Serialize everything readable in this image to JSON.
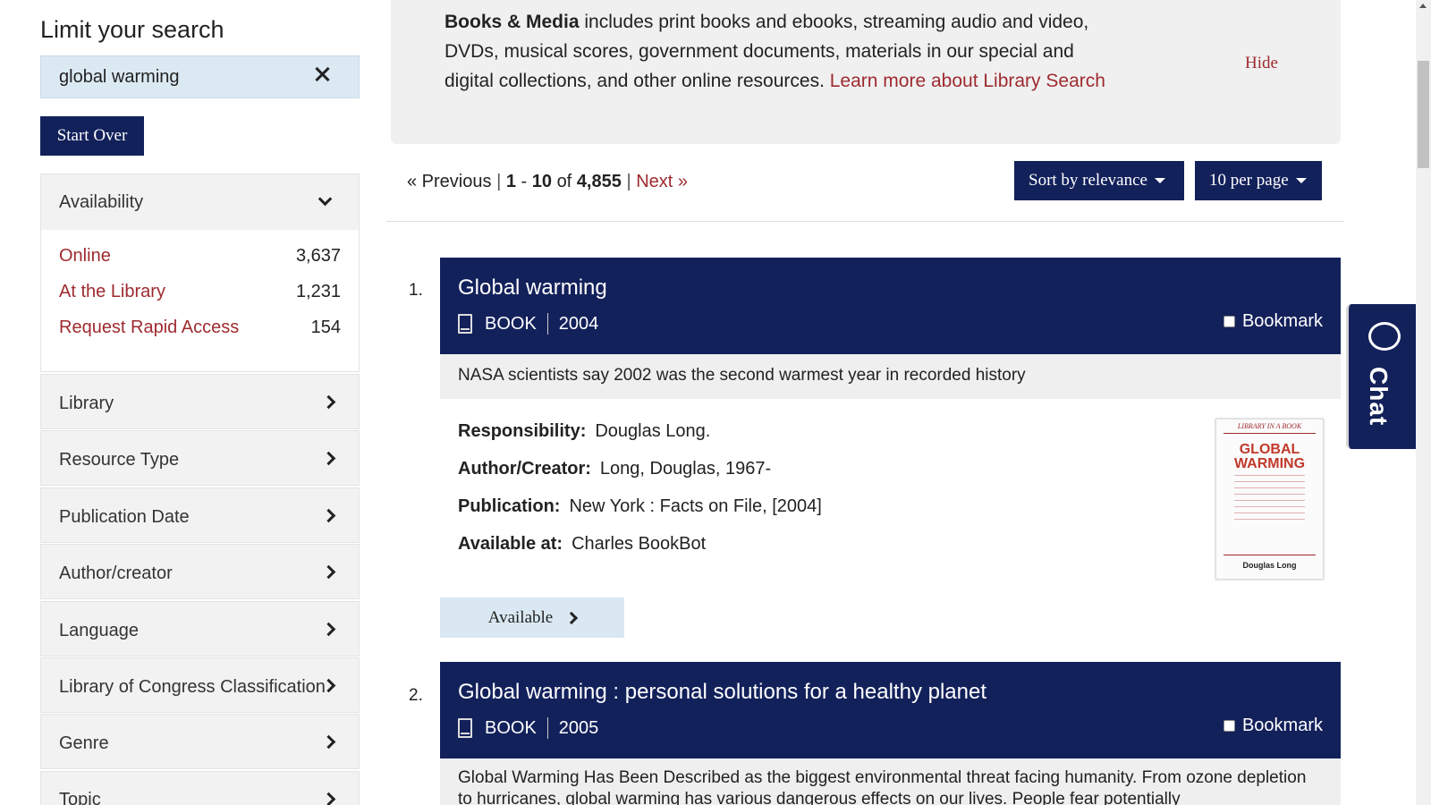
{
  "sidebar": {
    "title": "Limit your search",
    "search_value": "global warming",
    "start_over": "Start Over",
    "availability": {
      "label": "Availability",
      "items": [
        {
          "label": "Online",
          "count": "3,637"
        },
        {
          "label": "At the Library",
          "count": "1,231"
        },
        {
          "label": "Request Rapid Access",
          "count": "154"
        }
      ]
    },
    "facets": [
      "Library",
      "Resource Type",
      "Publication Date",
      "Author/creator",
      "Language",
      "Library of Congress Classification",
      "Genre",
      "Topic"
    ]
  },
  "notice": {
    "bold": "Books & Media",
    "text": " includes print books and ebooks, streaming audio and video, DVDs, musical scores, government documents, materials in our special and digital collections, and other online resources. ",
    "link": "Learn more about Library Search",
    "hide": "Hide"
  },
  "pager": {
    "previous": "« Previous",
    "sep": "|",
    "start": "1",
    "dash": "-",
    "end": "10",
    "of": "of",
    "total": "4,855",
    "next": "Next »"
  },
  "toolbar": {
    "sort_label": "Sort by relevance",
    "per_page_label": "10 per page"
  },
  "results": [
    {
      "num": "1.",
      "title": "Global warming",
      "format": "BOOK",
      "year": "2004",
      "bookmark": "Bookmark",
      "summary": "NASA scientists say 2002 was the second warmest year in recorded history",
      "fields": [
        {
          "label": "Responsibility:",
          "value": "Douglas Long."
        },
        {
          "label": "Author/Creator:",
          "value": "Long, Douglas, 1967-"
        },
        {
          "label": "Publication:",
          "value": "New York : Facts on File, [2004]"
        },
        {
          "label": "Available at:",
          "value": "Charles BookBot"
        }
      ],
      "cover": {
        "series": "LIBRARY IN A BOOK",
        "title1": "GLOBAL",
        "title2": "WARMING",
        "author": "Douglas Long"
      },
      "availability_button": "Available"
    },
    {
      "num": "2.",
      "title": "Global warming : personal solutions for a healthy planet",
      "format": "BOOK",
      "year": "2005",
      "bookmark": "Bookmark",
      "summary": "Global Warming Has Been Described as the biggest environmental threat facing humanity. From ozone depletion to hurricanes, global warming has various dangerous effects on our lives. People fear potentially"
    }
  ],
  "chat": {
    "label": "Chat"
  },
  "colors": {
    "navy": "#13215b",
    "link": "#9e2a2f",
    "light_blue": "#d9e8f2"
  }
}
